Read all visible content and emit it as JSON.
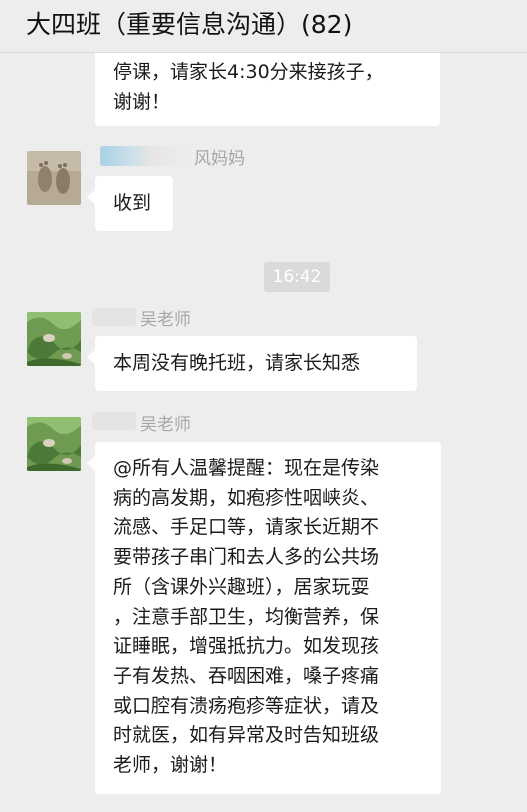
{
  "header": {
    "title": "大四班（重要信息沟通）(82)"
  },
  "messages": [
    {
      "text": "停课，请家长4:30分来接孩子，\n谢谢！"
    },
    {
      "sender": "风妈妈",
      "text": "收到"
    },
    {
      "timestamp": "16:42"
    },
    {
      "sender": "吴老师",
      "text": "本周没有晚托班，请家长知悉"
    },
    {
      "sender": "吴老师",
      "text": "@所有人温馨提醒：现在是传染\n病的高发期，如疱疹性咽峡炎、\n流感、手足口等，请家长近期不\n要带孩子串门和去人多的公共场\n所（含课外兴趣班），居家玩耍\n，注意手部卫生，均衡营养，保\n证睡眠，增强抵抗力。如发现孩\n子有发热、吞咽困难，嗓子疼痛\n或口腔有溃疡疱疹等症状，请及\n时就医，如有异常及时告知班级\n老师，谢谢！"
    }
  ],
  "colors": {
    "background": "#ededed",
    "bubble": "#ffffff",
    "sender_name": "#a7a7a7",
    "timestamp_bg": "#dadada"
  }
}
